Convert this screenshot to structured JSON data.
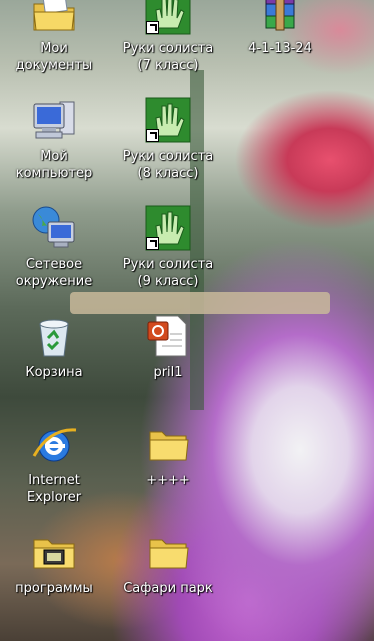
{
  "desktop": {
    "icons": [
      {
        "label": "Мои\nдокументы",
        "icon": "my-documents-icon"
      },
      {
        "label": "Руки солиста\n(7 класс)",
        "icon": "green-hand-icon"
      },
      {
        "label": "4-1-13-24",
        "icon": "winrar-archive-icon"
      },
      {
        "label": "Мой\nкомпьютер",
        "icon": "my-computer-icon"
      },
      {
        "label": "Руки солиста\n(8 класс)",
        "icon": "green-hand-icon"
      },
      {
        "label": "Сетевое\nокружение",
        "icon": "network-places-icon"
      },
      {
        "label": "Руки солиста\n(9 класс)",
        "icon": "green-hand-icon"
      },
      {
        "label": "Корзина",
        "icon": "recycle-bin-icon"
      },
      {
        "label": "pril1",
        "icon": "powerpoint-document-icon"
      },
      {
        "label": "Internet\nExplorer",
        "icon": "internet-explorer-icon"
      },
      {
        "label": "++++",
        "icon": "folder-icon"
      },
      {
        "label": "программы",
        "icon": "programs-folder-icon"
      },
      {
        "label": "Сафари парк",
        "icon": "folder-icon"
      }
    ]
  }
}
